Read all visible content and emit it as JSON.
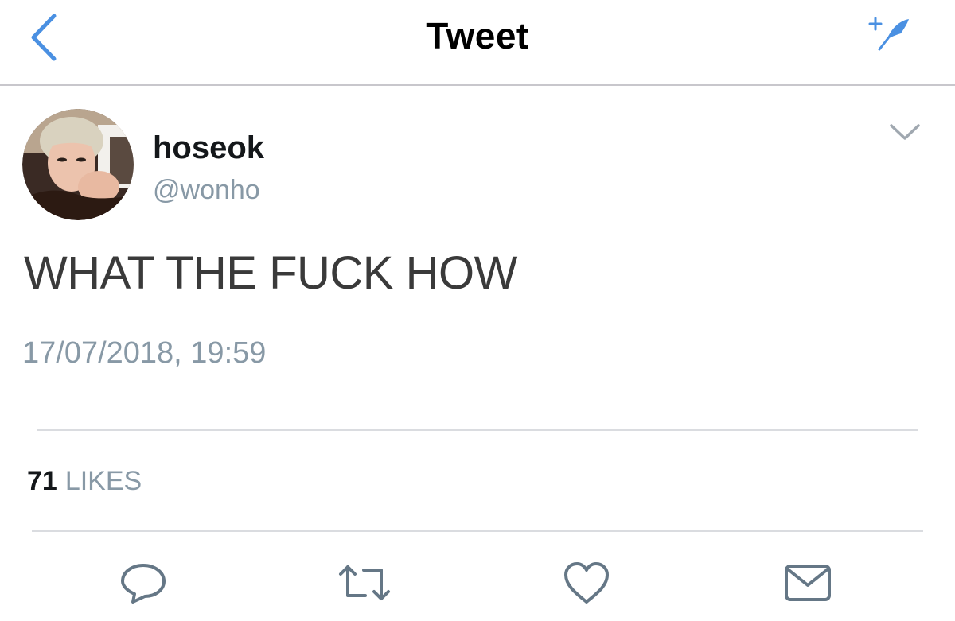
{
  "nav": {
    "title": "Tweet",
    "back_icon": "chevron-left-icon",
    "compose_icon": "compose-tweet-icon",
    "accent_color": "#4a90e2"
  },
  "tweet": {
    "author": {
      "display_name": "hoseok",
      "handle": "@wonho",
      "avatar_icon": "user-avatar"
    },
    "menu_icon": "chevron-down-icon",
    "text": "WHAT THE FUCK HOW",
    "timestamp": "17/07/2018, 19:59"
  },
  "stats": {
    "likes_count": "71",
    "likes_label": "LIKES"
  },
  "actions": [
    {
      "icon": "reply-icon"
    },
    {
      "icon": "retweet-icon"
    },
    {
      "icon": "like-icon"
    },
    {
      "icon": "share-icon"
    }
  ],
  "colors": {
    "text_primary": "#14171a",
    "text_secondary": "#8899a6",
    "divider": "#dadce0",
    "icon_gray": "#657786"
  }
}
